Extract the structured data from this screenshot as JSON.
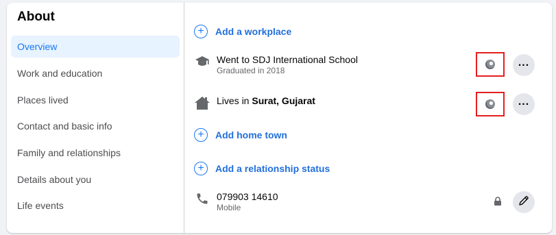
{
  "sidebar": {
    "title": "About",
    "items": [
      {
        "label": "Overview"
      },
      {
        "label": "Work and education"
      },
      {
        "label": "Places lived"
      },
      {
        "label": "Contact and basic info"
      },
      {
        "label": "Family and relationships"
      },
      {
        "label": "Details about you"
      },
      {
        "label": "Life events"
      }
    ]
  },
  "main": {
    "add_workplace": "Add a workplace",
    "education": {
      "prefix": "Went to ",
      "school": "SDJ International School",
      "detail": "Graduated in 2018",
      "privacy_icon": "globe-icon"
    },
    "lives_in": {
      "prefix": "Lives in ",
      "place": "Surat, Gujarat",
      "privacy_icon": "globe-icon"
    },
    "add_home_town": "Add home town",
    "add_relationship": "Add a relationship status",
    "phone": {
      "number": "079903 14610",
      "type": "Mobile",
      "privacy_icon": "lock-icon"
    }
  },
  "colors": {
    "accent": "#1877f2",
    "highlight_box": "#e41e1e",
    "active_bg": "#e7f3ff"
  }
}
